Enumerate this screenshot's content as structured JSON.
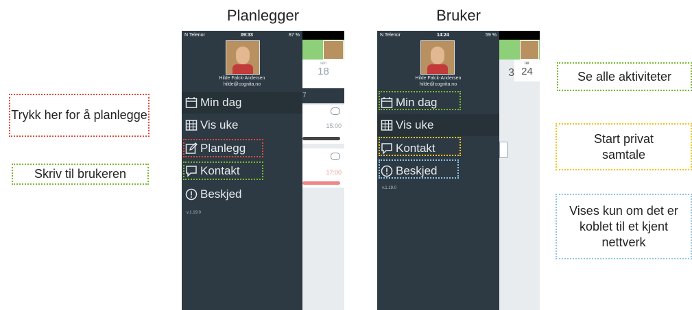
{
  "panels": {
    "left_title": "Planlegger",
    "right_title": "Bruker"
  },
  "annotations": {
    "plan": "Trykk her for å planlegge",
    "write": "Skriv til brukeren",
    "see_all": "Se alle aktiviteter",
    "private": "Start privat samtale",
    "network": "Vises kun om det er koblet til et kjent nettverk"
  },
  "phone_left": {
    "carrier": "N Telenor",
    "time": "09:33",
    "battery": "87 %",
    "user_name": "Hilde Falck-Andersen",
    "user_email": "hilde@cognita.no",
    "menu": [
      "Min dag",
      "Vis uke",
      "Planlegg",
      "Kontakt",
      "Beskjed"
    ],
    "version": "v.1.19.0",
    "day_abbr": "søn",
    "day_num": "18",
    "row_num": "7",
    "time1": "15:00",
    "time2": "17:00"
  },
  "phone_right": {
    "carrier": "N Telenor",
    "time": "14:24",
    "battery": "59 %",
    "user_name": "Hilde Falck-Andersen",
    "user_email": "hilde@cognita.no",
    "menu": [
      "Min dag",
      "Vis uke",
      "Kontakt",
      "Beskjed"
    ],
    "version": "v.1.19.0",
    "day_prev": "3",
    "day_abbr": "lør",
    "day_num": "24"
  },
  "colors": {
    "drawer": "#2d3a44",
    "accent_green": "#8ed07a",
    "dot_red": "#e5483a",
    "dot_green": "#7ab830",
    "dot_yellow": "#f2c21a",
    "dot_blue": "#8fc4e6"
  }
}
